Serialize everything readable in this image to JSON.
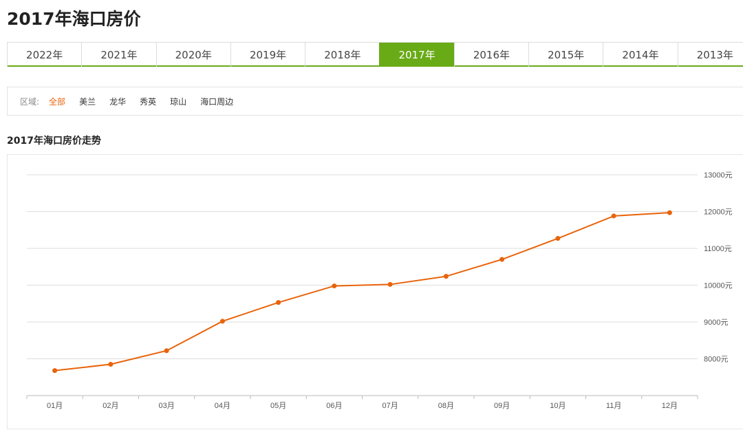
{
  "page": {
    "title": "2017年海口房价"
  },
  "year_tabs": [
    {
      "label": "2022年"
    },
    {
      "label": "2021年"
    },
    {
      "label": "2020年"
    },
    {
      "label": "2019年"
    },
    {
      "label": "2018年"
    },
    {
      "label": "2017年",
      "active": true
    },
    {
      "label": "2016年"
    },
    {
      "label": "2015年"
    },
    {
      "label": "2014年"
    },
    {
      "label": "2013年"
    }
  ],
  "region": {
    "label": "区域:",
    "items": [
      {
        "label": "全部",
        "active": true
      },
      {
        "label": "美兰"
      },
      {
        "label": "龙华"
      },
      {
        "label": "秀英"
      },
      {
        "label": "琼山"
      },
      {
        "label": "海口周边"
      }
    ]
  },
  "colors": {
    "accent_green": "#69aa17",
    "line_orange": "#e8630a"
  },
  "chart_data": {
    "type": "line",
    "title": "2017年海口房价走势",
    "categories": [
      "01月",
      "02月",
      "03月",
      "04月",
      "05月",
      "06月",
      "07月",
      "08月",
      "09月",
      "10月",
      "11月",
      "12月"
    ],
    "series": [
      {
        "values": [
          7680,
          7850,
          8220,
          9020,
          9530,
          9980,
          10020,
          10240,
          10700,
          11270,
          11880,
          11970
        ]
      }
    ],
    "yticks": [
      "8000元",
      "9000元",
      "10000元",
      "11000元",
      "12000元",
      "13000元"
    ],
    "ylim": [
      7000,
      13000
    ],
    "grid": true
  }
}
